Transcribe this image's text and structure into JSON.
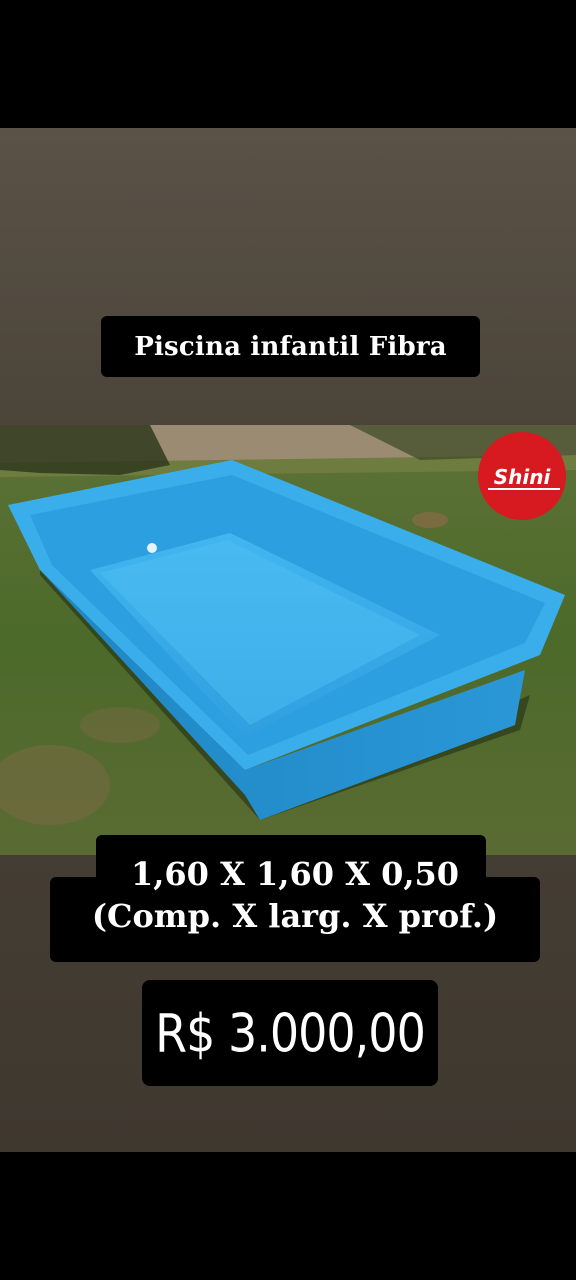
{
  "post": {
    "title": "Piscina infantil Fibra",
    "dimensions_line1": "1,60 X 1,60 X 0,50",
    "dimensions_line2": "(Comp. X larg. X prof.)",
    "price": "R$ 3.000,00"
  },
  "photo": {
    "subject": "blue fiberglass pool on lawn",
    "logo_text": "Shini",
    "colors": {
      "pool": "#2aa3e3",
      "grass": "#4f6b2c",
      "logo": "#d71920"
    }
  }
}
